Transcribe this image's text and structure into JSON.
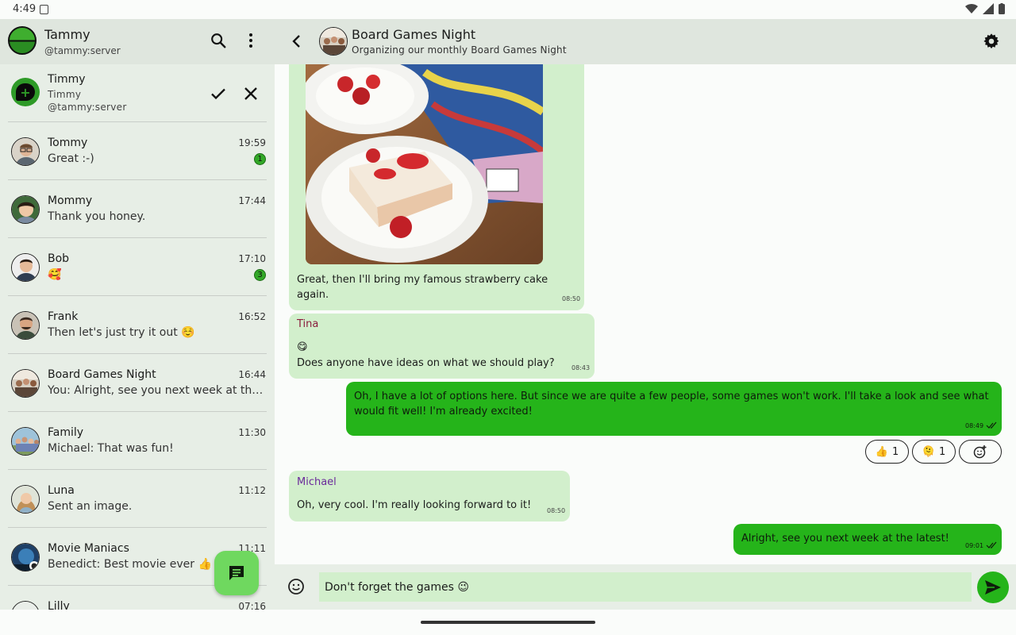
{
  "status_bar": {
    "time": "4:49"
  },
  "sidebar": {
    "account": {
      "name": "Tammy",
      "id": "@tammy:server"
    },
    "invite": {
      "name": "Timmy",
      "subtitle": "Timmy",
      "id": "@tammy:server"
    },
    "chats": [
      {
        "name": "Tommy",
        "last": "Great :-)",
        "time": "19:59",
        "badge": "1"
      },
      {
        "name": "Mommy",
        "last": "Thank you honey.",
        "time": "17:44"
      },
      {
        "name": "Bob",
        "last": "🥰",
        "time": "17:10",
        "badge": "3"
      },
      {
        "name": "Frank",
        "last": "Then let's just try it out ☺️",
        "time": "16:52"
      },
      {
        "name": "Board Games Night",
        "last": "You: Alright, see you next week at the latest!",
        "time": "16:44"
      },
      {
        "name": "Family",
        "last": "Michael: That was fun!",
        "time": "11:30"
      },
      {
        "name": "Luna",
        "last": "Sent an image.",
        "time": "11:12"
      },
      {
        "name": "Movie Maniacs",
        "last": "Benedict: Best movie ever 👍",
        "time": "11:11"
      },
      {
        "name": "Lilly",
        "last": "",
        "time": "07:16"
      }
    ]
  },
  "room": {
    "name": "Board Games Night",
    "topic": "Organizing our monthly Board Games Night"
  },
  "messages": [
    {
      "text": "Great, then I'll bring my famous strawberry cake again.",
      "time": "08:50"
    },
    {
      "sender": "Tina",
      "emoji": "😋",
      "text": "Does anyone have ideas on what we should play?",
      "time": "08:43"
    },
    {
      "text": "Oh, I have a lot of options here. But since we are quite a few people, some games won't work. I'll take a look and see what would fit well! I'm already excited!",
      "time": "08:49"
    },
    {
      "sender": "Michael",
      "text": "Oh, very cool. I'm really looking forward to it!",
      "time": "08:50"
    },
    {
      "text": "Alright, see you next week at the latest!",
      "time": "09:01"
    }
  ],
  "reactions": [
    {
      "emoji": "👍",
      "count": "1"
    },
    {
      "emoji": "🫠",
      "count": "1"
    }
  ],
  "composer": {
    "value": "Don't forget the games 😉"
  },
  "colors": {
    "accent": "#25b41a",
    "bubble_in": "#d2efcc",
    "tina": "#8a1c3c",
    "michael": "#6a2a9a"
  }
}
